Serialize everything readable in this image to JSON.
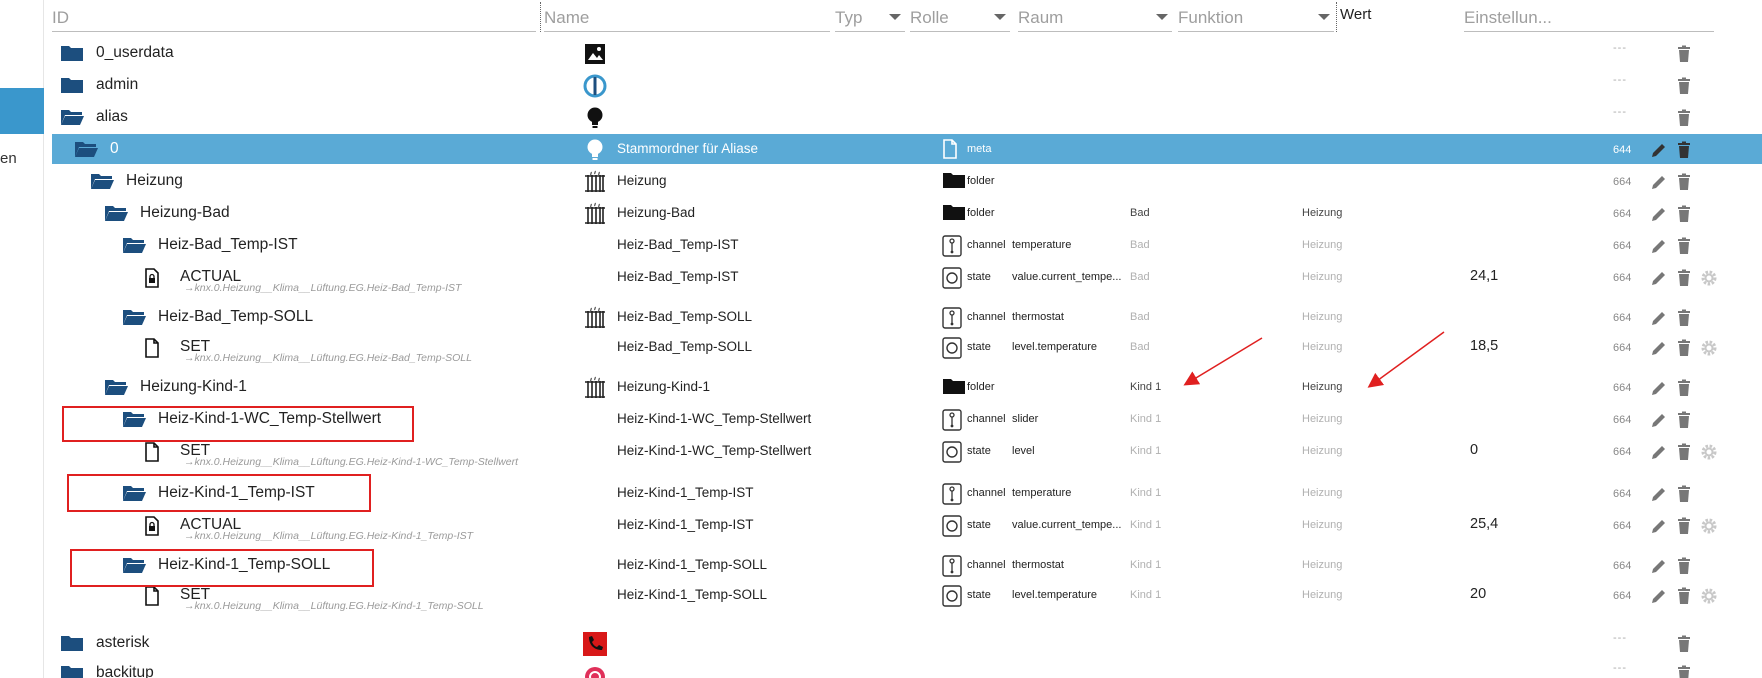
{
  "left": {
    "cut_label": "en"
  },
  "header": {
    "id": "ID",
    "name": "Name",
    "type": "Typ",
    "role": "Rolle",
    "room": "Raum",
    "function": "Funktion",
    "value": "Wert",
    "settings": "Einstellun..."
  },
  "rows": [
    {
      "label": "0_userdata",
      "icon": "folder-icon",
      "name_icon": "image-icon",
      "name": "",
      "type": "",
      "role": "",
      "room": "",
      "func": "",
      "value": "",
      "perm": "---"
    },
    {
      "label": "admin",
      "icon": "folder-icon",
      "name_icon": "admin-logo-icon",
      "name": "",
      "type": "",
      "role": "",
      "room": "",
      "func": "",
      "value": "",
      "perm": "---"
    },
    {
      "label": "alias",
      "icon": "folder-open-icon",
      "name_icon": "lightbulb-icon",
      "name": "",
      "type": "",
      "role": "",
      "room": "",
      "func": "",
      "value": "",
      "perm": "---"
    },
    {
      "label": "0",
      "icon": "folder-open-icon",
      "name_icon": "lightbulb-icon",
      "name": "Stammordner für Aliase",
      "type_icon": "file-icon",
      "type": "meta",
      "role": "",
      "room": "",
      "func": "",
      "value": "",
      "perm": "644"
    },
    {
      "label": "Heizung",
      "icon": "folder-open-icon",
      "name_icon": "radiator-icon",
      "name": "Heizung",
      "type_icon": "folder-icon",
      "type": "folder",
      "role": "",
      "room": "",
      "func": "",
      "value": "",
      "perm": "664"
    },
    {
      "label": "Heizung-Bad",
      "icon": "folder-open-icon",
      "name_icon": "radiator-icon",
      "name": "Heizung-Bad",
      "type_icon": "folder-icon",
      "type": "folder",
      "role": "",
      "room": "Bad",
      "func": "Heizung",
      "value": "",
      "perm": "664"
    },
    {
      "label": "Heiz-Bad_Temp-IST",
      "icon": "folder-open-icon",
      "name": "Heiz-Bad_Temp-IST",
      "type_icon": "channel-icon",
      "type": "channel",
      "role": "temperature",
      "room": "Bad",
      "func": "Heizung",
      "value": "",
      "perm": "664"
    },
    {
      "label": "ACTUAL",
      "sub": "→knx.0.Heizung__Klima__Lüftung.EG.Heiz-Bad_Temp-IST",
      "icon": "file-lock-icon",
      "name": "Heiz-Bad_Temp-IST",
      "type_icon": "state-icon",
      "type": "state",
      "role": "value.current_tempe...",
      "room": "Bad",
      "func": "Heizung",
      "value": "24,1",
      "perm": "664"
    },
    {
      "label": "Heiz-Bad_Temp-SOLL",
      "icon": "folder-open-icon",
      "name_icon": "radiator-icon",
      "name": "Heiz-Bad_Temp-SOLL",
      "type_icon": "channel-icon",
      "type": "channel",
      "role": "thermostat",
      "room": "Bad",
      "func": "Heizung",
      "value": "",
      "perm": "664"
    },
    {
      "label": "SET",
      "sub": "→knx.0.Heizung__Klima__Lüftung.EG.Heiz-Bad_Temp-SOLL",
      "icon": "file-icon",
      "name": "Heiz-Bad_Temp-SOLL",
      "type_icon": "state-icon",
      "type": "state",
      "role": "level.temperature",
      "room": "Bad",
      "func": "Heizung",
      "value": "18,5",
      "perm": "664"
    },
    {
      "label": "Heizung-Kind-1",
      "icon": "folder-open-icon",
      "name_icon": "radiator-icon",
      "name": "Heizung-Kind-1",
      "type_icon": "folder-icon",
      "type": "folder",
      "role": "",
      "room": "Kind 1",
      "func": "Heizung",
      "value": "",
      "perm": "664"
    },
    {
      "label": "Heiz-Kind-1-WC_Temp-Stellwert",
      "icon": "folder-open-icon",
      "name": "Heiz-Kind-1-WC_Temp-Stellwert",
      "type_icon": "channel-icon",
      "type": "channel",
      "role": "slider",
      "room": "Kind 1",
      "func": "Heizung",
      "value": "",
      "perm": "664"
    },
    {
      "label": "SET",
      "sub": "→knx.0.Heizung__Klima__Lüftung.EG.Heiz-Kind-1-WC_Temp-Stellwert",
      "icon": "file-icon",
      "name": "Heiz-Kind-1-WC_Temp-Stellwert",
      "type_icon": "state-icon",
      "type": "state",
      "role": "level",
      "room": "Kind 1",
      "func": "Heizung",
      "value": "0",
      "perm": "664"
    },
    {
      "label": "Heiz-Kind-1_Temp-IST",
      "icon": "folder-open-icon",
      "name": "Heiz-Kind-1_Temp-IST",
      "type_icon": "channel-icon",
      "type": "channel",
      "role": "temperature",
      "room": "Kind 1",
      "func": "Heizung",
      "value": "",
      "perm": "664"
    },
    {
      "label": "ACTUAL",
      "sub": "→knx.0.Heizung__Klima__Lüftung.EG.Heiz-Kind-1_Temp-IST",
      "icon": "file-lock-icon",
      "name": "Heiz-Kind-1_Temp-IST",
      "type_icon": "state-icon",
      "type": "state",
      "role": "value.current_tempe...",
      "room": "Kind 1",
      "func": "Heizung",
      "value": "25,4",
      "perm": "664"
    },
    {
      "label": "Heiz-Kind-1_Temp-SOLL",
      "icon": "folder-open-icon",
      "name": "Heiz-Kind-1_Temp-SOLL",
      "type_icon": "channel-icon",
      "type": "channel",
      "role": "thermostat",
      "room": "Kind 1",
      "func": "Heizung",
      "value": "",
      "perm": "664"
    },
    {
      "label": "SET",
      "sub": "→knx.0.Heizung__Klima__Lüftung.EG.Heiz-Kind-1_Temp-SOLL",
      "icon": "file-icon",
      "name": "Heiz-Kind-1_Temp-SOLL",
      "type_icon": "state-icon",
      "type": "state",
      "role": "level.temperature",
      "room": "Kind 1",
      "func": "Heizung",
      "value": "20",
      "perm": "664"
    },
    {
      "label": "asterisk",
      "icon": "folder-icon",
      "name_icon": "asterisk-phone-icon",
      "name": "",
      "type": "",
      "role": "",
      "room": "",
      "func": "",
      "value": "",
      "perm": "---"
    },
    {
      "label": "backitup",
      "icon": "folder-icon",
      "name_icon": "backitup-icon",
      "name": "",
      "type": "",
      "role": "",
      "room": "",
      "func": "",
      "value": "",
      "perm": "---"
    }
  ],
  "colors": {
    "folder": "#1c4e7e",
    "selected_row": "#5aaad6",
    "annotation": "#e02020",
    "accent": "#3a97cc"
  }
}
